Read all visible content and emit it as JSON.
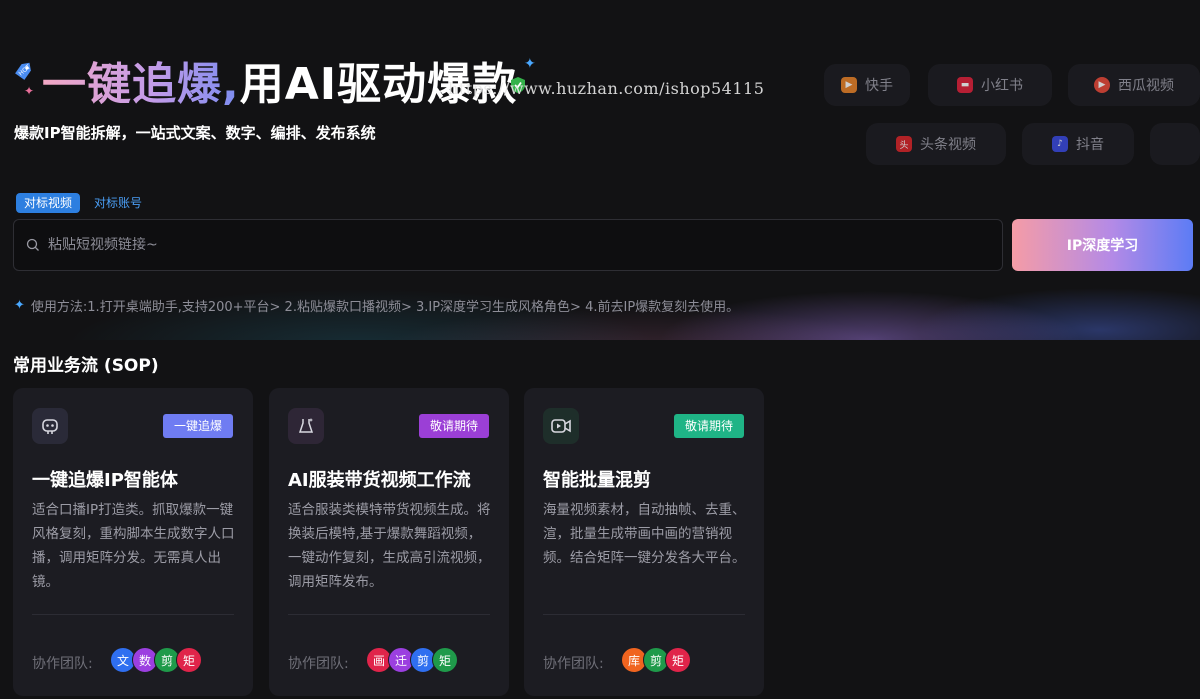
{
  "hero": {
    "title_gradient": "一键追爆,",
    "title_white": "用AI驱动爆款",
    "subtitle": "爆款IP智能拆解，一站式文案、数字、编排、发布系统",
    "watermark": "https://www.huzhan.com/ishop54115"
  },
  "platforms": [
    {
      "label": "快手",
      "icon": "kuaishou-icon",
      "color": "#e8832a"
    },
    {
      "label": "小红书",
      "icon": "xiaohongshu-icon",
      "color": "#e0233c"
    },
    {
      "label": "西瓜视频",
      "icon": "xigua-icon",
      "color": "#e84a3a"
    },
    {
      "label": "头条视频",
      "icon": "toutiao-icon",
      "color": "#d9262b"
    },
    {
      "label": "抖音",
      "icon": "douyin-icon",
      "color": "#3a4be0"
    }
  ],
  "search": {
    "tabs": [
      "对标视频",
      "对标账号"
    ],
    "placeholder": "粘贴短视频链接~",
    "button": "IP深度学习",
    "usage": "使用方法:1.打开桌端助手,支持200+平台> 2.粘贴爆款口播视频> 3.IP深度学习生成风格角色> 4.前去IP爆款复刻去使用。"
  },
  "sop": {
    "title": "常用业务流 (SOP)",
    "cards": [
      {
        "icon": "robot-icon",
        "badge": "一键追爆",
        "badge_color": "#6f7cf2",
        "title": "一键追爆IP智能体",
        "desc": "适合口播IP打造类。抓取爆款一键风格复刻，重构脚本生成数字人口播，调用矩阵分发。无需真人出镜。",
        "team_label": "协作团队:",
        "team": [
          {
            "t": "文",
            "c": "#2f6ff0"
          },
          {
            "t": "数",
            "c": "#9b3fe0"
          },
          {
            "t": "剪",
            "c": "#1f9a4a"
          },
          {
            "t": "矩",
            "c": "#e0244a"
          }
        ]
      },
      {
        "icon": "dress-sparkle-icon",
        "badge": "敬请期待",
        "badge_color": "#9b3fd6",
        "title": "AI服装带货视频工作流",
        "desc": "适合服装类模特带货视频生成。将换装后模特,基于爆款舞蹈视频，一键动作复刻，生成高引流视频，调用矩阵发布。",
        "team_label": "协作团队:",
        "team": [
          {
            "t": "画",
            "c": "#e0244a"
          },
          {
            "t": "迁",
            "c": "#9b3fe0"
          },
          {
            "t": "剪",
            "c": "#2f6ff0"
          },
          {
            "t": "矩",
            "c": "#1f9a4a"
          }
        ]
      },
      {
        "icon": "video-camera-icon",
        "badge": "敬请期待",
        "badge_color": "#1fb486",
        "title": "智能批量混剪",
        "desc": "海量视频素材，自动抽帧、去重、渲，批量生成带画中画的营销视频。结合矩阵一键分发各大平台。",
        "team_label": "协作团队:",
        "team": [
          {
            "t": "库",
            "c": "#f0641f"
          },
          {
            "t": "剪",
            "c": "#1f9a4a"
          },
          {
            "t": "矩",
            "c": "#e0244a"
          }
        ]
      }
    ]
  }
}
